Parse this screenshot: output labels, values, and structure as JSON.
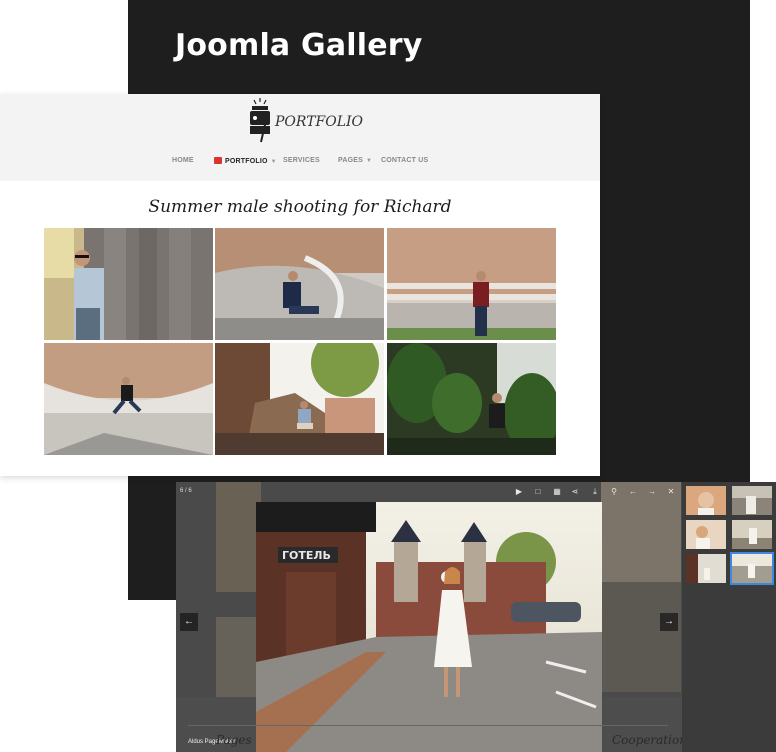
{
  "promo": {
    "title": "Joomla Gallery"
  },
  "site": {
    "logo_text": "PORTFOLIO",
    "nav": [
      {
        "label": "HOME",
        "active": false,
        "has_caret": false
      },
      {
        "label": "PORTFOLIO",
        "active": true,
        "has_caret": true
      },
      {
        "label": "SERVICES",
        "active": false,
        "has_caret": false
      },
      {
        "label": "PAGES",
        "active": false,
        "has_caret": true
      },
      {
        "label": "CONTACT US",
        "active": false,
        "has_caret": false
      }
    ],
    "gallery_title": "Summer male shooting for Richard",
    "photos": [
      "man-sunglasses-column",
      "man-sitting-stairs",
      "man-standing-building",
      "man-jumping-track",
      "man-sitting-ruins",
      "man-plants-greenhouse"
    ]
  },
  "lightbox": {
    "counter": "6 / 6",
    "toolbar_icons": [
      "play-icon",
      "fullscreen-icon",
      "grid-icon",
      "share-icon",
      "download-icon",
      "zoom-icon",
      "prev-icon",
      "next-icon",
      "close-icon"
    ],
    "prev_arrow": "←",
    "next_arrow": "→",
    "caption": "Aldus PageMaker",
    "bottom_texts": [
      "Pages",
      "Cooperation"
    ],
    "main_photo": "woman-white-dress-street",
    "hotel_sign": "ГОТЕЛЬ",
    "thumbnails": 6,
    "active_thumbnail": 6
  },
  "colors": {
    "accent": "#3f88e0",
    "dark_bg": "#1e1e1e",
    "badge": "#d9352e"
  }
}
